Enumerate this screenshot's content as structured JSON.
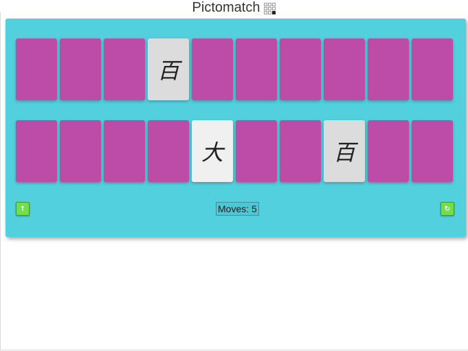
{
  "app": {
    "title": "Pictomatch",
    "title_icon": "grid-icon"
  },
  "colors": {
    "board": "#53d0dd",
    "card_back": "#bd4ba8",
    "card_face_matched": "#dcdcdc",
    "card_face_selected": "#f0f0f0",
    "button": "#6fe04a"
  },
  "board": {
    "rows": [
      {
        "cards": [
          {
            "state": "hidden",
            "symbol": ""
          },
          {
            "state": "hidden",
            "symbol": ""
          },
          {
            "state": "hidden",
            "symbol": ""
          },
          {
            "state": "matched",
            "symbol": "百"
          },
          {
            "state": "hidden",
            "symbol": ""
          },
          {
            "state": "hidden",
            "symbol": ""
          },
          {
            "state": "hidden",
            "symbol": ""
          },
          {
            "state": "hidden",
            "symbol": ""
          },
          {
            "state": "hidden",
            "symbol": ""
          },
          {
            "state": "hidden",
            "symbol": ""
          }
        ]
      },
      {
        "cards": [
          {
            "state": "hidden",
            "symbol": ""
          },
          {
            "state": "hidden",
            "symbol": ""
          },
          {
            "state": "hidden",
            "symbol": ""
          },
          {
            "state": "hidden",
            "symbol": ""
          },
          {
            "state": "selected",
            "symbol": "大"
          },
          {
            "state": "hidden",
            "symbol": ""
          },
          {
            "state": "hidden",
            "symbol": ""
          },
          {
            "state": "matched",
            "symbol": "百"
          },
          {
            "state": "hidden",
            "symbol": ""
          },
          {
            "state": "hidden",
            "symbol": ""
          }
        ]
      }
    ]
  },
  "footer": {
    "up_button_icon": "arrow-up-icon",
    "moves_label": "Moves: 5",
    "restart_button_icon": "restart-icon"
  }
}
